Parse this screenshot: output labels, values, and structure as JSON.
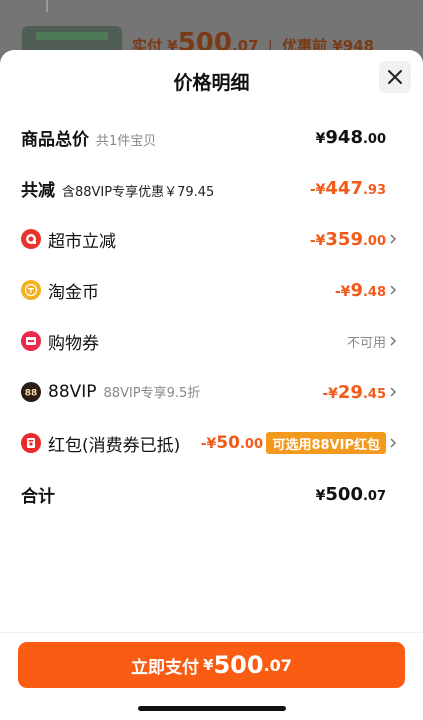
{
  "background": {
    "price_label": "实付",
    "price_yen": "¥",
    "price_int": "500",
    "price_dec": ".07",
    "separator": "|",
    "original_label": "优惠前",
    "original_value": "¥948"
  },
  "sheet": {
    "title": "价格明细"
  },
  "total_price": {
    "label": "商品总价",
    "sub": "共1件宝贝",
    "yen": "¥",
    "int": "948",
    "dec": ".00"
  },
  "discount_total": {
    "label": "共减",
    "sub": "含88VIP专享优惠￥79.45",
    "prefix": "-¥",
    "int": "447",
    "dec": ".93"
  },
  "items": [
    {
      "label": "超市立减",
      "prefix": "-¥",
      "int": "359",
      "dec": ".00"
    },
    {
      "label": "淘金币",
      "prefix": "-¥",
      "int": "9",
      "dec": ".48"
    },
    {
      "label": "购物券",
      "status": "不可用"
    },
    {
      "label": "88VIP",
      "sub": "88VIP专享9.5折",
      "prefix": "-¥",
      "int": "29",
      "dec": ".45"
    },
    {
      "label": "红包(消费券已抵)",
      "prefix": "-¥",
      "int": "50",
      "dec": ".00",
      "tag": "可选用88VIP红包"
    }
  ],
  "sum": {
    "label": "合计",
    "yen": "¥",
    "int": "500",
    "dec": ".07"
  },
  "pay_button": {
    "label": "立即支付",
    "yen": "¥",
    "int": "500",
    "dec": ".07"
  },
  "colors": {
    "accent": "#fb5c13",
    "discount": "#f25a1a",
    "tag": "#f39a1e"
  },
  "icons": [
    "close-icon",
    "supermarket-icon",
    "taojinbi-coin-icon",
    "coupon-icon",
    "vip88-icon",
    "red-packet-icon",
    "chevron-right-icon"
  ]
}
